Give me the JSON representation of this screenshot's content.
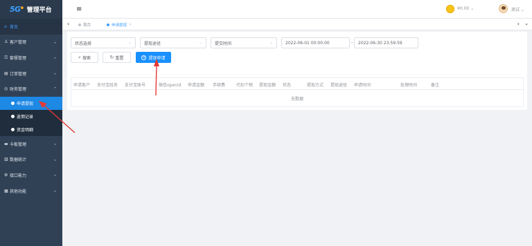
{
  "brand": {
    "logo_badge": "5G",
    "title": "管理平台"
  },
  "sidebar": {
    "items": [
      {
        "icon": "⌂",
        "label": "首页"
      },
      {
        "icon": "♙",
        "label": "客户管理"
      },
      {
        "icon": "☶",
        "label": "套餐管理"
      },
      {
        "icon": "▤",
        "label": "订单管理"
      },
      {
        "icon": "◎",
        "label": "财务管理"
      }
    ],
    "finance_sub": [
      {
        "label": "申请提现"
      },
      {
        "label": "返佣记录"
      },
      {
        "label": "资金明细"
      }
    ],
    "items_after": [
      {
        "icon": "▬",
        "label": "卡板管理"
      },
      {
        "icon": "▥",
        "label": "数据统计"
      },
      {
        "icon": "⚙",
        "label": "接口能力"
      },
      {
        "icon": "▦",
        "label": "其他功能"
      }
    ]
  },
  "header": {
    "balance": "¥0.00",
    "user": "测试"
  },
  "tags": {
    "home": "首页",
    "current": "申请提现"
  },
  "filters": {
    "status_placeholder": "状态选择",
    "channel_placeholder": "提现途径",
    "time_type": "提交时间",
    "date_start": "2022-06-01 00:00:00",
    "date_end": "2022-06-30 23:59:59",
    "range_sep": "-"
  },
  "buttons": {
    "search": "搜索",
    "reset": "重置",
    "apply": "提现申请"
  },
  "table": {
    "columns": [
      "申请客户",
      "支付宝姓名",
      "支付宝账号",
      "微信openid",
      "申请金额",
      "手续费",
      "代扣个税",
      "提现金额",
      "状态",
      "提现方式",
      "提现途径",
      "申请时间",
      "处理时间",
      "备注"
    ],
    "empty_text": "无数据"
  },
  "colors": {
    "sidebar_bg": "#304156",
    "active_sub": "#1e88e5",
    "primary": "#1890ff",
    "annotation": "#e53935"
  }
}
